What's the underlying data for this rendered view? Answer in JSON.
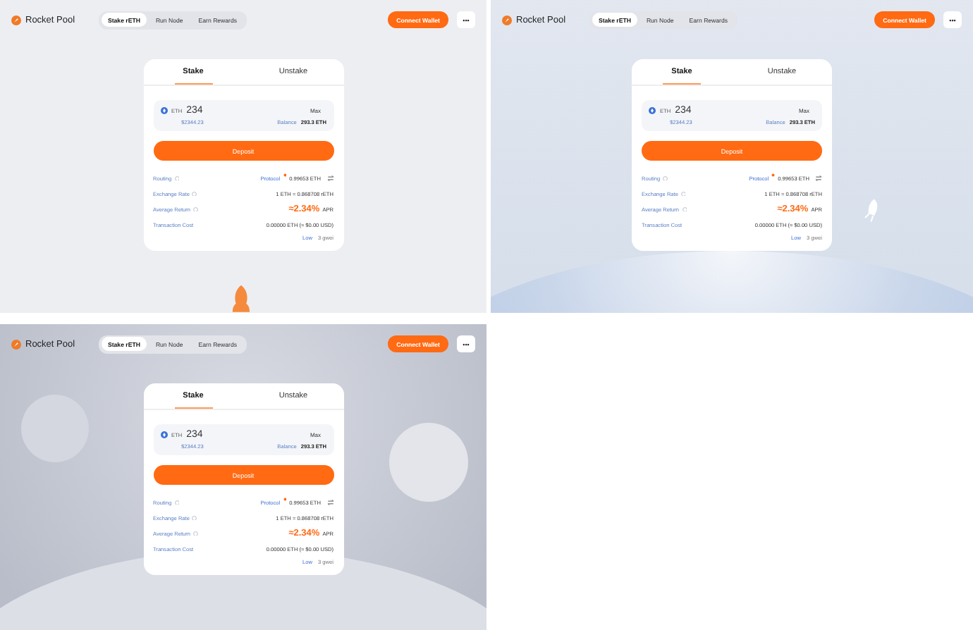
{
  "panels": [
    {
      "kind": "plain",
      "logo": "Rocket Pool",
      "nav_tabs": [
        {
          "label": "Stake rETH",
          "selected": true
        },
        {
          "label": "Run Node",
          "selected": false
        },
        {
          "label": "Earn Rewards",
          "selected": false
        }
      ],
      "connect_button": "Connect Wallet",
      "more_button": "•••",
      "card": {
        "tabs": [
          {
            "label": "Stake",
            "selected": true
          },
          {
            "label": "Unstake",
            "selected": false
          }
        ],
        "token": "ETH",
        "amount": "234",
        "max_button": "Max",
        "fiat_value": "$2344.23",
        "balance_label": "Balance",
        "balance": "293.3 ETH",
        "deposit_button": "Deposit",
        "routing_label": "Routing",
        "routing_source": "Protocol",
        "routing_value": "0.99653 ETH",
        "exchange_label": "Exchange Rate",
        "exchange_value": "1 ETH = 0.868708 rETH",
        "return_label": "Average Return",
        "return_value": "≈2.34%",
        "return_unit": "APR",
        "cost_label": "Transaction Cost",
        "cost_value": "0.00000 ETH (≈ $0.00 USD)",
        "gas_speed": "Low",
        "gas_price": "3 gwei"
      }
    },
    {
      "kind": "space",
      "logo": "Rocket Pool",
      "nav_tabs": [
        {
          "label": "Stake rETH",
          "selected": true
        },
        {
          "label": "Run Node",
          "selected": false
        },
        {
          "label": "Earn Rewards",
          "selected": false
        }
      ],
      "connect_button": "Connect Wallet",
      "more_button": "•••",
      "card": {
        "tabs": [
          {
            "label": "Stake",
            "selected": true
          },
          {
            "label": "Unstake",
            "selected": false
          }
        ],
        "token": "ETH",
        "amount": "234",
        "max_button": "Max",
        "fiat_value": "$2344.23",
        "balance_label": "Balance",
        "balance": "293.3 ETH",
        "deposit_button": "Deposit",
        "routing_label": "Routing",
        "routing_source": "Protocol",
        "routing_value": "0.99653 ETH",
        "exchange_label": "Exchange Rate",
        "exchange_value": "1 ETH = 0.868708 rETH",
        "return_label": "Average Return",
        "return_value": "≈2.34%",
        "return_unit": "APR",
        "cost_label": "Transaction Cost",
        "cost_value": "0.00000 ETH (≈ $0.00 USD)",
        "gas_speed": "Low",
        "gas_price": "3 gwei"
      }
    },
    {
      "kind": "moon",
      "logo": "Rocket Pool",
      "nav_tabs": [
        {
          "label": "Stake rETH",
          "selected": true
        },
        {
          "label": "Run Node",
          "selected": false
        },
        {
          "label": "Earn Rewards",
          "selected": false
        }
      ],
      "connect_button": "Connect Wallet",
      "more_button": "•••",
      "card": {
        "tabs": [
          {
            "label": "Stake",
            "selected": true
          },
          {
            "label": "Unstake",
            "selected": false
          }
        ],
        "token": "ETH",
        "amount": "234",
        "max_button": "Max",
        "fiat_value": "$2344.23",
        "balance_label": "Balance",
        "balance": "293.3 ETH",
        "deposit_button": "Deposit",
        "routing_label": "Routing",
        "routing_source": "Protocol",
        "routing_value": "0.99653 ETH",
        "exchange_label": "Exchange Rate",
        "exchange_value": "1 ETH = 0.868708 rETH",
        "return_label": "Average Return",
        "return_value": "≈2.34%",
        "return_unit": "APR",
        "cost_label": "Transaction Cost",
        "cost_value": "0.00000 ETH (≈ $0.00 USD)",
        "gas_speed": "Low",
        "gas_price": "3 gwei"
      }
    }
  ]
}
